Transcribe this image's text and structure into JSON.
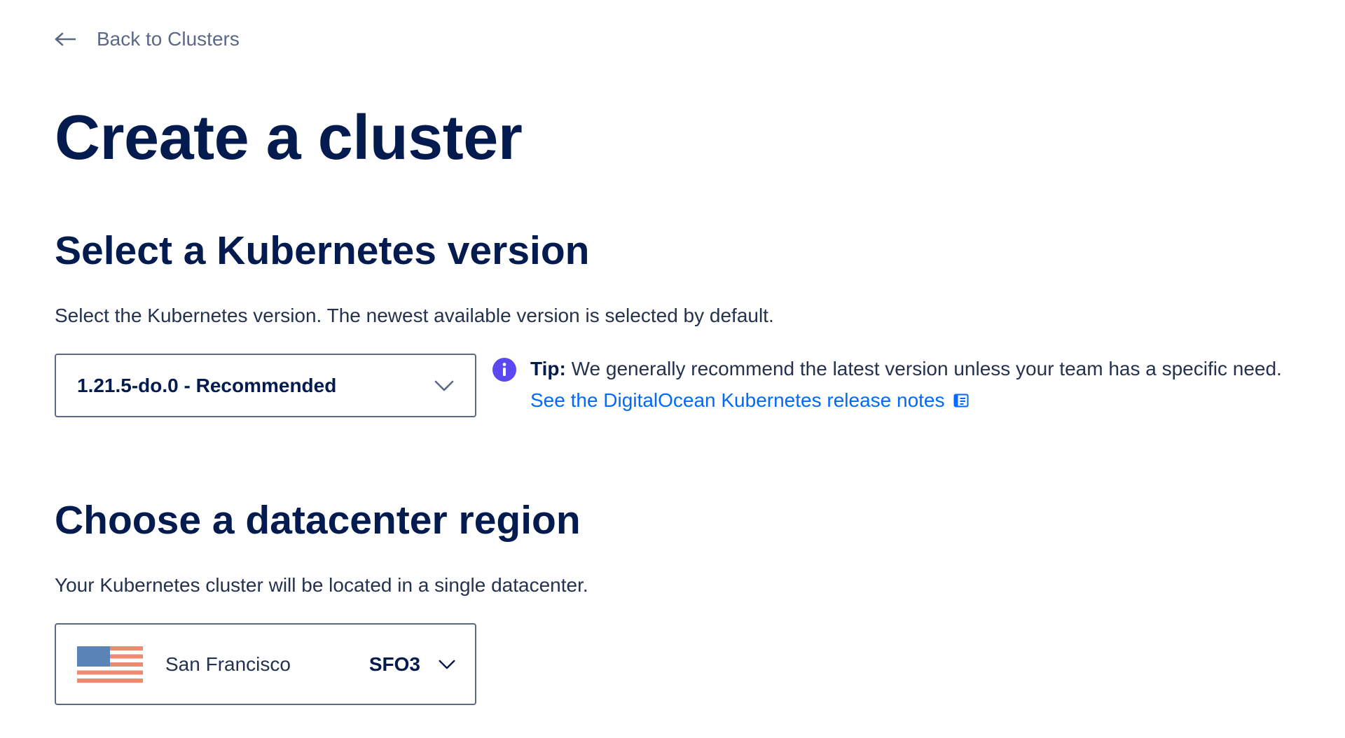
{
  "nav": {
    "back_label": "Back to Clusters"
  },
  "page": {
    "title": "Create a cluster"
  },
  "version_section": {
    "title": "Select a Kubernetes version",
    "description": "Select the Kubernetes version. The newest available version is selected by default.",
    "selected_version": "1.21.5-do.0 - Recommended",
    "tip_label": "Tip:",
    "tip_text": " We generally recommend the latest version unless your team has a specific need.",
    "release_notes_link": "See the DigitalOcean Kubernetes release notes"
  },
  "region_section": {
    "title": "Choose a datacenter region",
    "description": "Your Kubernetes cluster will be located in a single datacenter.",
    "selected_region_name": "San Francisco",
    "selected_region_code": "SFO3",
    "flag_icon": "us-flag-icon"
  },
  "colors": {
    "heading": "#031b4e",
    "body_text": "#24324f",
    "muted": "#5b6987",
    "link": "#0069ff",
    "info_icon": "#5a48f3",
    "flag_red": "#f08a6e",
    "flag_blue": "#5a84b7"
  }
}
